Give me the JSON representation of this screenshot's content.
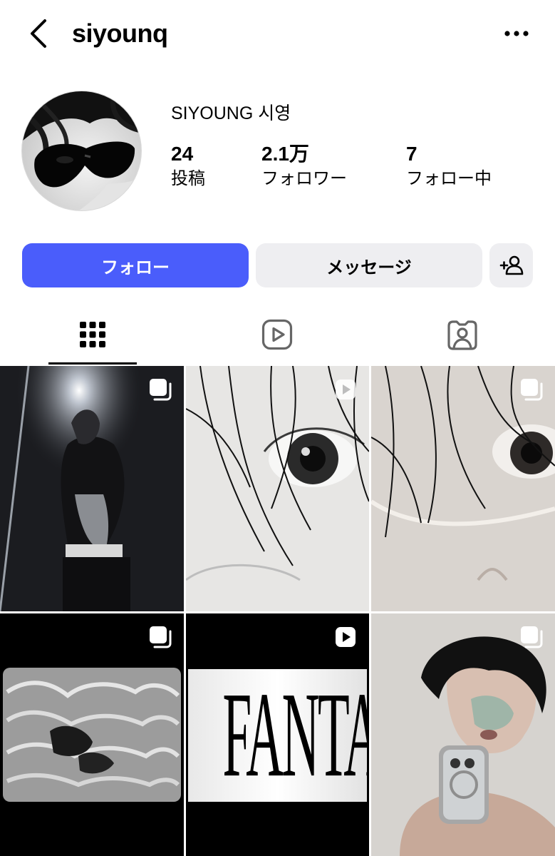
{
  "header": {
    "username": "siyounq",
    "back_icon": "chevron-left-icon",
    "more_icon": "more-horizontal-icon"
  },
  "profile": {
    "display_name": "SIYOUNG 시영",
    "stats": [
      {
        "value": "24",
        "label": "投稿"
      },
      {
        "value": "2.1万",
        "label": "フォロワー"
      },
      {
        "value": "7",
        "label": "フォロー中"
      }
    ]
  },
  "actions": {
    "follow_label": "フォロー",
    "message_label": "メッセージ",
    "suggest_icon": "add-person-icon",
    "follow_color": "#4a5dfb"
  },
  "tabs": [
    {
      "icon": "grid-icon",
      "active": true
    },
    {
      "icon": "reels-icon",
      "active": false
    },
    {
      "icon": "tagged-icon",
      "active": false
    }
  ],
  "posts": [
    {
      "type": "carousel",
      "description_icon": "carousel-icon"
    },
    {
      "type": "reel",
      "description_icon": "reel-play-icon"
    },
    {
      "type": "carousel",
      "description_icon": "carousel-icon"
    },
    {
      "type": "carousel",
      "description_icon": "carousel-icon"
    },
    {
      "type": "reel",
      "description_icon": "reel-play-icon",
      "text": "FANTASY"
    },
    {
      "type": "carousel",
      "description_icon": "carousel-icon"
    }
  ]
}
